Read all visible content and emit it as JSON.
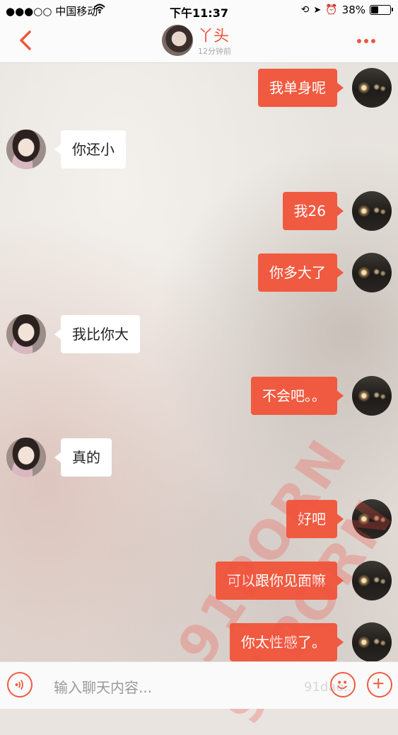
{
  "status_bar": {
    "carrier": "●●●○○ 中国移动",
    "time": "下午11:37",
    "battery": "38%"
  },
  "header": {
    "contact_name": "丫头",
    "last_seen": "12分钟前",
    "accent_color": "#f0553c"
  },
  "messages": [
    {
      "from": "me",
      "text": "我单身呢"
    },
    {
      "from": "her",
      "text": "你还小"
    },
    {
      "from": "me",
      "text": "我26"
    },
    {
      "from": "me",
      "text": "你多大了"
    },
    {
      "from": "her",
      "text": "我比你大"
    },
    {
      "from": "me",
      "text": "不会吧。。"
    },
    {
      "from": "her",
      "text": "真的"
    },
    {
      "from": "me",
      "text": "好吧"
    },
    {
      "from": "me",
      "text": "可以跟你见面嘛"
    },
    {
      "from": "me",
      "text": "你太性感了。"
    }
  ],
  "input": {
    "placeholder": "输入聊天内容..."
  },
  "watermark": {
    "text": "91PORN",
    "corner_text": "91dao..."
  }
}
